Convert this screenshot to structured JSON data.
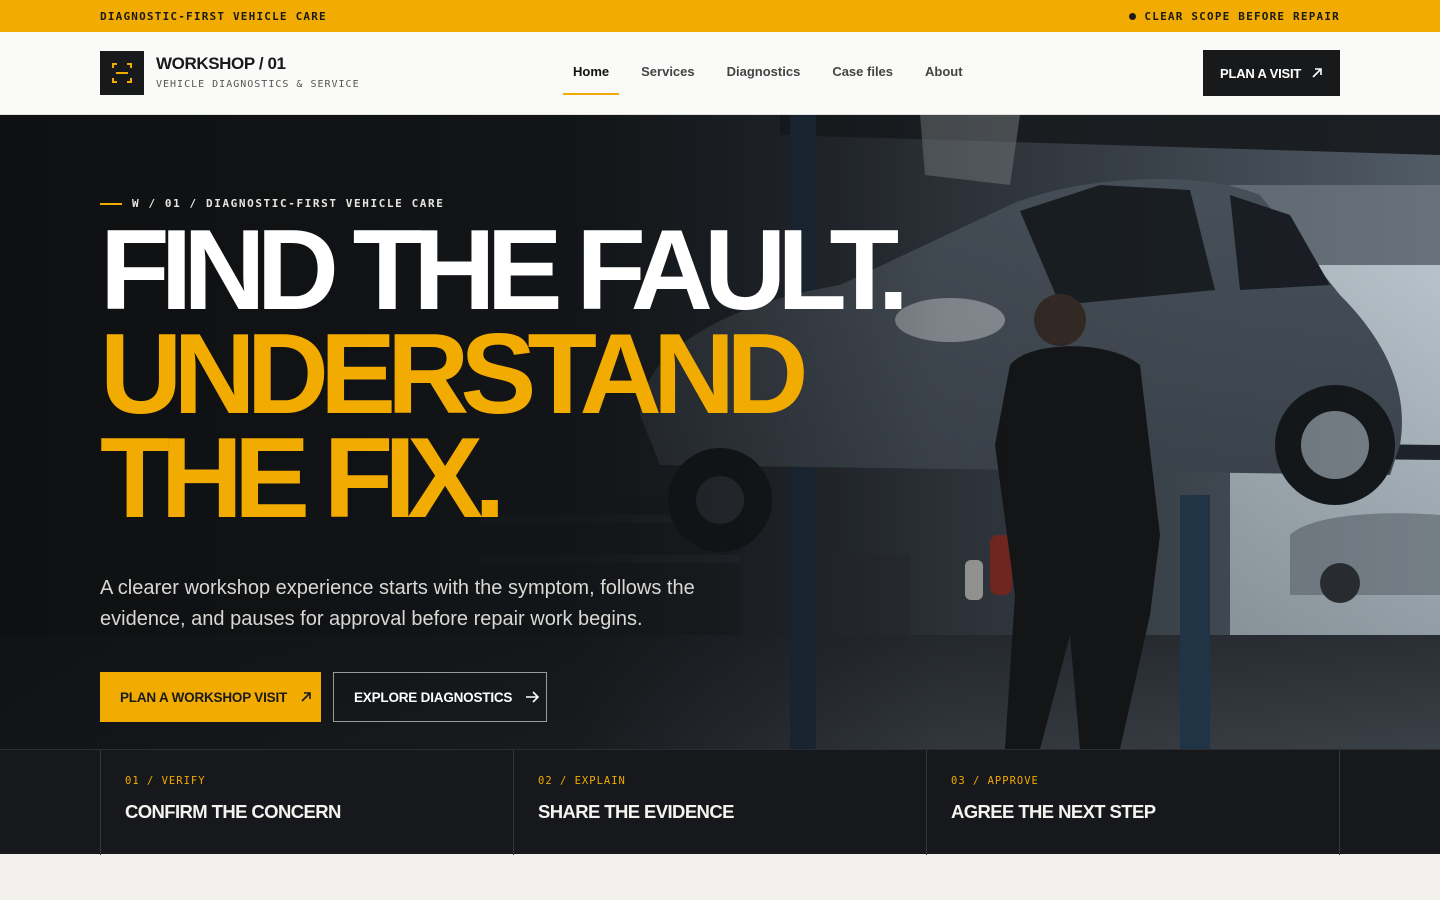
{
  "topbar": {
    "left": "DIAGNOSTIC-FIRST VEHICLE CARE",
    "right": "CLEAR SCOPE BEFORE REPAIR"
  },
  "header": {
    "brand": "WORKSHOP / 01",
    "tagline": "VEHICLE DIAGNOSTICS & SERVICE",
    "nav": [
      "Home",
      "Services",
      "Diagnostics",
      "Case files",
      "About"
    ],
    "active_nav": "Home",
    "cta": "PLAN A VISIT"
  },
  "hero": {
    "eyebrow": "W / 01 / DIAGNOSTIC-FIRST VEHICLE CARE",
    "headline_1": "FIND THE FAULT.",
    "headline_2": "UNDERSTAND",
    "headline_3": "THE FIX.",
    "lede": "A clearer workshop experience starts with the symptom, follows the evidence, and pauses for approval before repair work begins.",
    "primary_cta": "PLAN A WORKSHOP VISIT",
    "secondary_cta": "EXPLORE DIAGNOSTICS",
    "image_alt_icons": [
      "car-on-lift",
      "mechanic"
    ]
  },
  "steps": [
    {
      "tag": "01 / VERIFY",
      "title": "CONFIRM THE CONCERN"
    },
    {
      "tag": "02 / EXPLAIN",
      "title": "SHARE THE EVIDENCE"
    },
    {
      "tag": "03 / APPROVE",
      "title": "AGREE THE NEXT STEP"
    }
  ],
  "colors": {
    "accent": "#f2ab00",
    "dark": "#17191b",
    "light": "#fafaf8"
  }
}
